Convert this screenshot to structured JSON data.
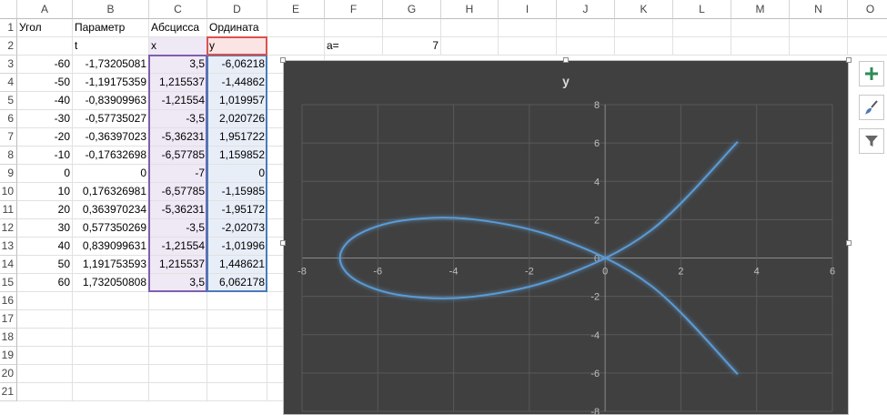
{
  "columns": [
    "A",
    "B",
    "C",
    "D",
    "E",
    "F",
    "G",
    "H",
    "I",
    "J",
    "K",
    "L",
    "M",
    "N",
    "O"
  ],
  "rows": [
    "1",
    "2",
    "3",
    "4",
    "5",
    "6",
    "7",
    "8",
    "9",
    "10",
    "11",
    "12",
    "13",
    "14",
    "15",
    "16",
    "17",
    "18",
    "19",
    "20",
    "21"
  ],
  "headers_row1": {
    "A": "Угол",
    "B": "Параметр",
    "C": "Абсцисса",
    "D": "Ордината"
  },
  "headers_row2": {
    "B": "t",
    "C": "x",
    "D": "y",
    "F": "a=",
    "G": "7"
  },
  "table": [
    {
      "angle": "-60",
      "t": "-1,73205081",
      "x": "3,5",
      "y": "-6,06218"
    },
    {
      "angle": "-50",
      "t": "-1,19175359",
      "x": "1,215537",
      "y": "-1,44862"
    },
    {
      "angle": "-40",
      "t": "-0,83909963",
      "x": "-1,21554",
      "y": "1,019957"
    },
    {
      "angle": "-30",
      "t": "-0,57735027",
      "x": "-3,5",
      "y": "2,020726"
    },
    {
      "angle": "-20",
      "t": "-0,36397023",
      "x": "-5,36231",
      "y": "1,951722"
    },
    {
      "angle": "-10",
      "t": "-0,17632698",
      "x": "-6,57785",
      "y": "1,159852"
    },
    {
      "angle": "0",
      "t": "0",
      "x": "-7",
      "y": "0"
    },
    {
      "angle": "10",
      "t": "0,176326981",
      "x": "-6,57785",
      "y": "-1,15985"
    },
    {
      "angle": "20",
      "t": "0,363970234",
      "x": "-5,36231",
      "y": "-1,95172"
    },
    {
      "angle": "30",
      "t": "0,577350269",
      "x": "-3,5",
      "y": "-2,02073"
    },
    {
      "angle": "40",
      "t": "0,839099631",
      "x": "-1,21554",
      "y": "-1,01996"
    },
    {
      "angle": "50",
      "t": "1,191753593",
      "x": "1,215537",
      "y": "1,448621"
    },
    {
      "angle": "60",
      "t": "1,732050808",
      "x": "3,5",
      "y": "6,062178"
    }
  ],
  "chart_data": {
    "type": "scatter",
    "title": "y",
    "xlim": [
      -8,
      6
    ],
    "ylim": [
      -8,
      8
    ],
    "x_ticks": [
      "-8",
      "-6",
      "-4",
      "-2",
      "0",
      "2",
      "4",
      "6"
    ],
    "y_ticks": [
      "8",
      "6",
      "4",
      "2",
      "0",
      "-2",
      "-4",
      "-6",
      "-8"
    ],
    "series": [
      {
        "x": [
          3.5,
          1.215537,
          -1.21554,
          -3.5,
          -5.36231,
          -6.57785,
          -7,
          -6.57785,
          -5.36231,
          -3.5,
          -1.21554,
          1.215537,
          3.5
        ],
        "y": [
          -6.06218,
          -1.44862,
          1.019957,
          2.020726,
          1.951722,
          1.159852,
          0,
          -1.15985,
          -1.95172,
          -2.02073,
          -1.01996,
          1.448621,
          6.062178
        ]
      }
    ],
    "line_color": "#5b9bd5",
    "background": "#404040",
    "grid": true
  },
  "side_buttons": [
    {
      "icon": "plus-icon"
    },
    {
      "icon": "brush-icon"
    },
    {
      "icon": "filter-icon"
    }
  ]
}
